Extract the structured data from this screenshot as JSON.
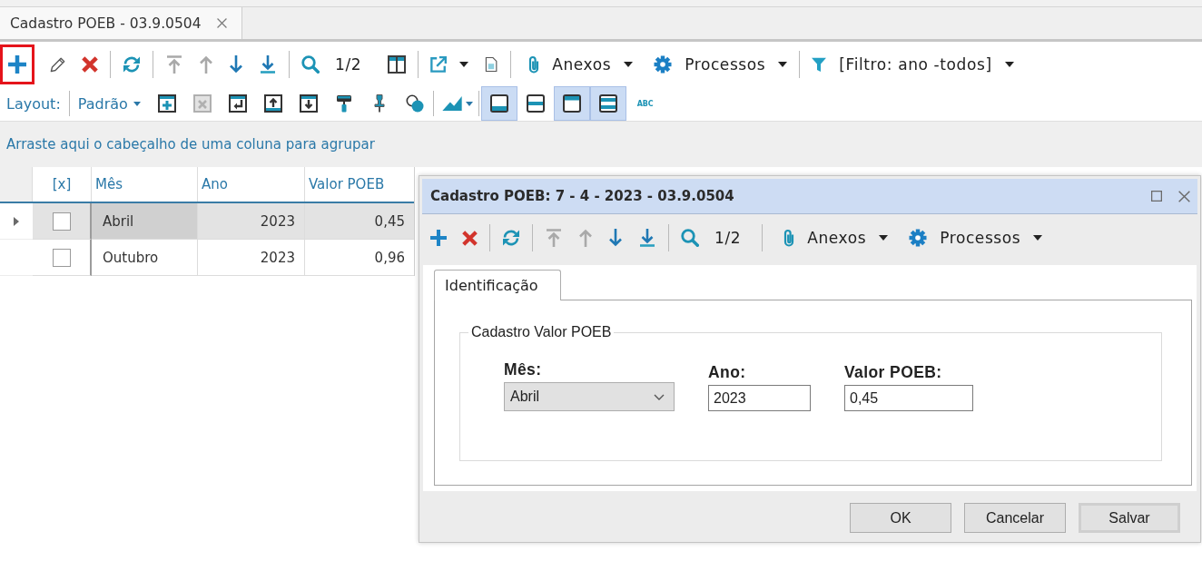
{
  "document_tabs": [
    {
      "label": "Cadastro POEB - 03.9.0504",
      "selected": true
    }
  ],
  "main_toolbar": {
    "add_highlighted": true,
    "navigation": [
      {
        "disabled": true
      },
      {
        "disabled": true
      },
      {
        "disabled": false
      },
      {
        "disabled": false
      }
    ],
    "page_counter": "1/2",
    "attachments": "Anexos",
    "processes": "Processos",
    "filter": "[Filtro: ano -todos]"
  },
  "layout_toolbar": {
    "label": "Layout:",
    "layout": "Padrão",
    "view_toggles": [
      {
        "selected": true
      },
      {
        "selected": false
      },
      {
        "selected": true
      },
      {
        "selected": true
      }
    ],
    "text_style": "ABC"
  },
  "group_panel": {
    "hint": "Arraste aqui o cabeçalho de uma coluna para agrupar"
  },
  "grid": {
    "columns": [
      "[x]",
      "Mês",
      "Ano",
      "Valor POEB"
    ],
    "rows": [
      {
        "selected": true,
        "cells": [
          {
            "kind": "checkbox",
            "checked": false
          },
          {
            "kind": "text",
            "text": "Abril"
          },
          {
            "kind": "number",
            "text": "2023"
          },
          {
            "kind": "number",
            "text": "0,45"
          }
        ]
      },
      {
        "selected": false,
        "cells": [
          {
            "kind": "checkbox",
            "checked": false
          },
          {
            "kind": "text",
            "text": "Outubro"
          },
          {
            "kind": "number",
            "text": "2023"
          },
          {
            "kind": "number",
            "text": "0,96"
          }
        ]
      }
    ]
  },
  "dialog": {
    "title": "Cadastro POEB: 7 - 4 - 2023 - 03.9.0504",
    "toolbar": {
      "navigation": [
        {
          "disabled": true
        },
        {
          "disabled": true
        },
        {
          "disabled": false
        },
        {
          "disabled": false
        }
      ],
      "page_counter": "1/2",
      "attachments": "Anexos",
      "processes": "Processos"
    },
    "tabs": [
      {
        "label": "Identificação",
        "selected": true
      }
    ],
    "group_title": "Cadastro Valor POEB",
    "fields": [
      {
        "kind": "select",
        "label": "Mês:",
        "value": "Abril"
      },
      {
        "kind": "text",
        "label": "Ano:",
        "value": "2023"
      },
      {
        "kind": "text",
        "label": "Valor POEB:",
        "value": "0,45"
      }
    ],
    "buttons": [
      {
        "label": "OK",
        "default": false
      },
      {
        "label": "Cancelar",
        "default": false
      },
      {
        "label": "Salvar",
        "default": true
      }
    ]
  }
}
